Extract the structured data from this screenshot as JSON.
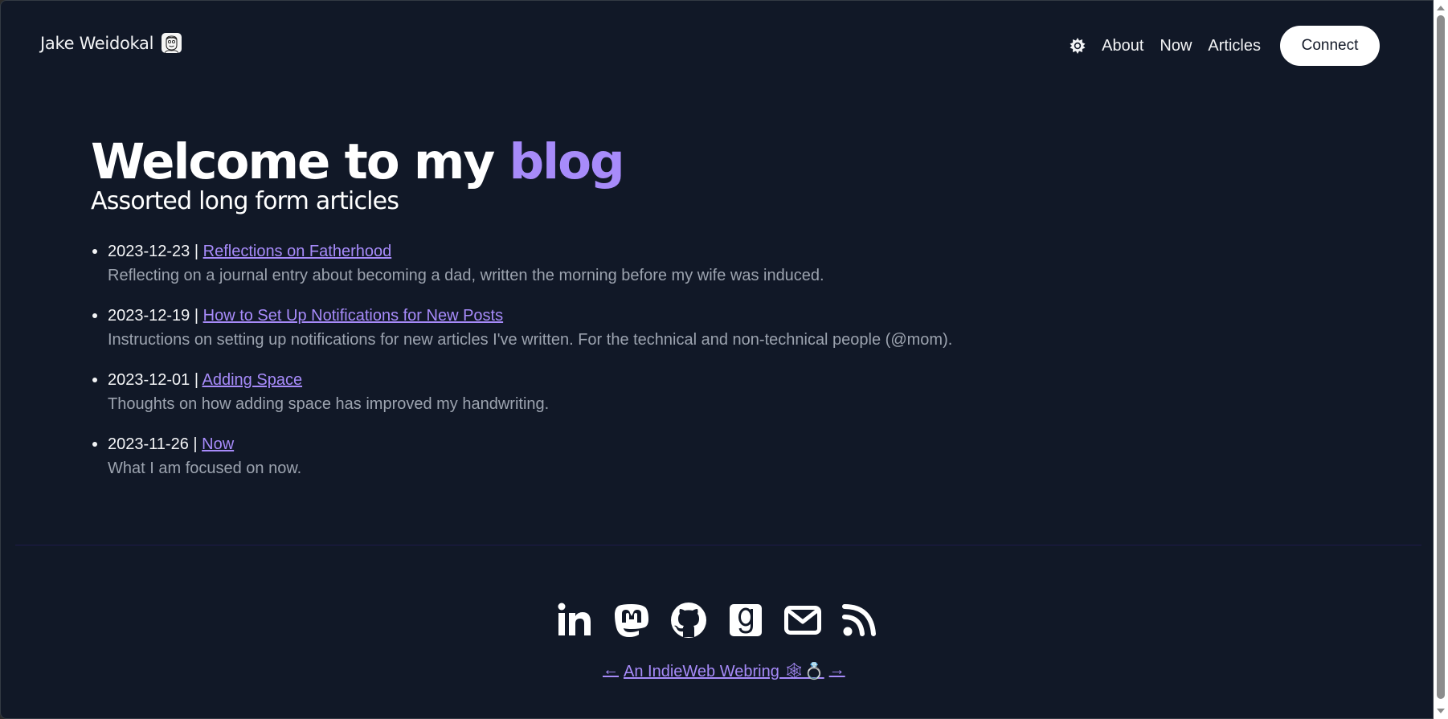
{
  "header": {
    "brand_name": "Jake Weidokal",
    "avatar_icon": "sketch-portrait-avatar",
    "theme_toggle_icon": "sun-gear-icon",
    "nav": [
      {
        "label": "About"
      },
      {
        "label": "Now"
      },
      {
        "label": "Articles"
      }
    ],
    "connect_label": "Connect"
  },
  "hero": {
    "title_prefix": "Welcome to my ",
    "title_accent": "blog",
    "subtitle": "Assorted long form articles",
    "accent_color": "#a78bfa"
  },
  "articles": [
    {
      "date": "2023-12-23",
      "separator": " | ",
      "title": "Reflections on Fatherhood",
      "description": "Reflecting on a journal entry about becoming a dad, written the morning before my wife was induced."
    },
    {
      "date": "2023-12-19",
      "separator": " | ",
      "title": "How to Set Up Notifications for New Posts",
      "description": "Instructions on setting up notifications for new articles I've written. For the technical and non-technical people (@mom)."
    },
    {
      "date": "2023-12-01",
      "separator": " | ",
      "title": "Adding Space",
      "description": "Thoughts on how adding space has improved my handwriting."
    },
    {
      "date": "2023-11-26",
      "separator": " | ",
      "title": "Now",
      "description": "What I am focused on now."
    }
  ],
  "footer": {
    "socials": [
      {
        "name": "linkedin-icon"
      },
      {
        "name": "mastodon-icon"
      },
      {
        "name": "github-icon"
      },
      {
        "name": "goodreads-icon"
      },
      {
        "name": "email-icon"
      },
      {
        "name": "rss-icon"
      }
    ],
    "webring": {
      "prev": "←",
      "label": "An IndieWeb Webring 🕸💍",
      "next": "→"
    }
  },
  "colors": {
    "background": "#111827",
    "text": "#f3f4f6",
    "muted": "#9ca3af",
    "accent": "#a78bfa",
    "divider": "#1e1b4b"
  }
}
